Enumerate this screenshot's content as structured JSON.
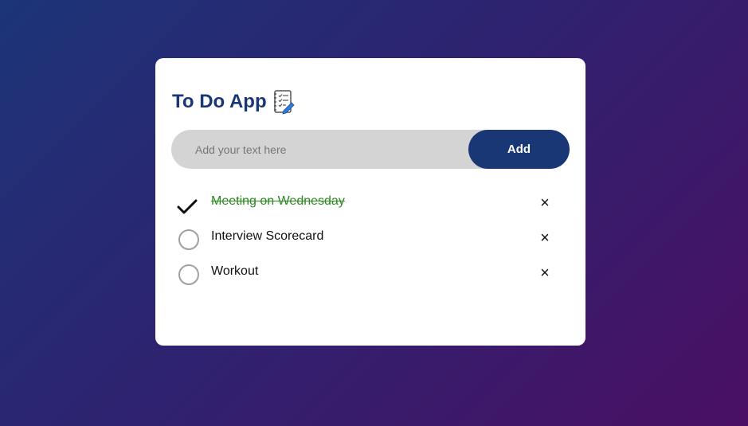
{
  "app": {
    "title": "To Do App",
    "icon": "notebook-checklist-icon"
  },
  "input": {
    "value": "",
    "placeholder": "Add your text here"
  },
  "add_button": {
    "label": "Add"
  },
  "colors": {
    "primary": "#1a3775",
    "done_text": "#2a8a1f",
    "input_bg": "#d4d4d4"
  },
  "tasks": [
    {
      "text": "Meeting on Wednesday",
      "checked": true,
      "delete_label": "×"
    },
    {
      "text": "Interview Scorecard",
      "checked": false,
      "delete_label": "×"
    },
    {
      "text": "Workout",
      "checked": false,
      "delete_label": "×"
    }
  ]
}
